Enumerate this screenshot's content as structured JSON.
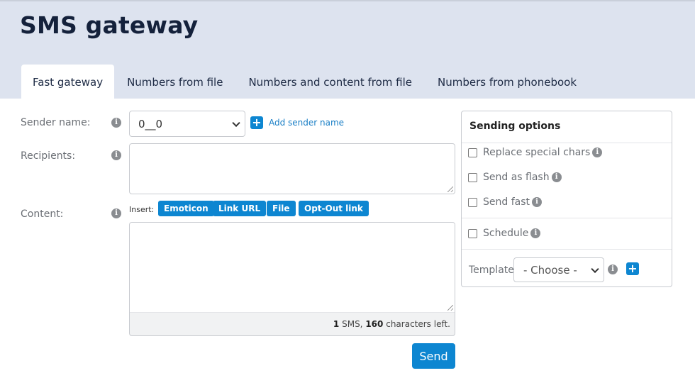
{
  "header": {
    "title": "SMS gateway",
    "tabs": [
      {
        "label": "Fast gateway",
        "active": true
      },
      {
        "label": "Numbers from file",
        "active": false
      },
      {
        "label": "Numbers and content from file",
        "active": false
      },
      {
        "label": "Numbers from phonebook",
        "active": false
      }
    ]
  },
  "form": {
    "sender_label": "Sender name:",
    "sender_value": "0__0",
    "add_sender_label": "Add sender name",
    "recipients_label": "Recipients:",
    "content_label": "Content:",
    "insert_label": "Insert:",
    "insert_buttons": [
      "Emoticon",
      "Link URL",
      "File",
      "Opt-Out link"
    ],
    "counter": {
      "sms_count": "1",
      "sms_text": "SMS,",
      "chars_left": "160",
      "chars_text": "characters left."
    },
    "send_label": "Send",
    "info_icon": "i",
    "plus_icon": "+"
  },
  "options": {
    "title": "Sending options",
    "items": [
      {
        "label": "Replace special chars",
        "checked": false
      },
      {
        "label": "Send as flash",
        "checked": false
      },
      {
        "label": "Send fast",
        "checked": false
      },
      {
        "label": "Schedule",
        "checked": false
      }
    ],
    "template_label": "Template",
    "template_value": "- Choose -"
  },
  "colors": {
    "accent": "#0d86d1",
    "header_bg": "#dde3ef",
    "title": "#14213b"
  }
}
